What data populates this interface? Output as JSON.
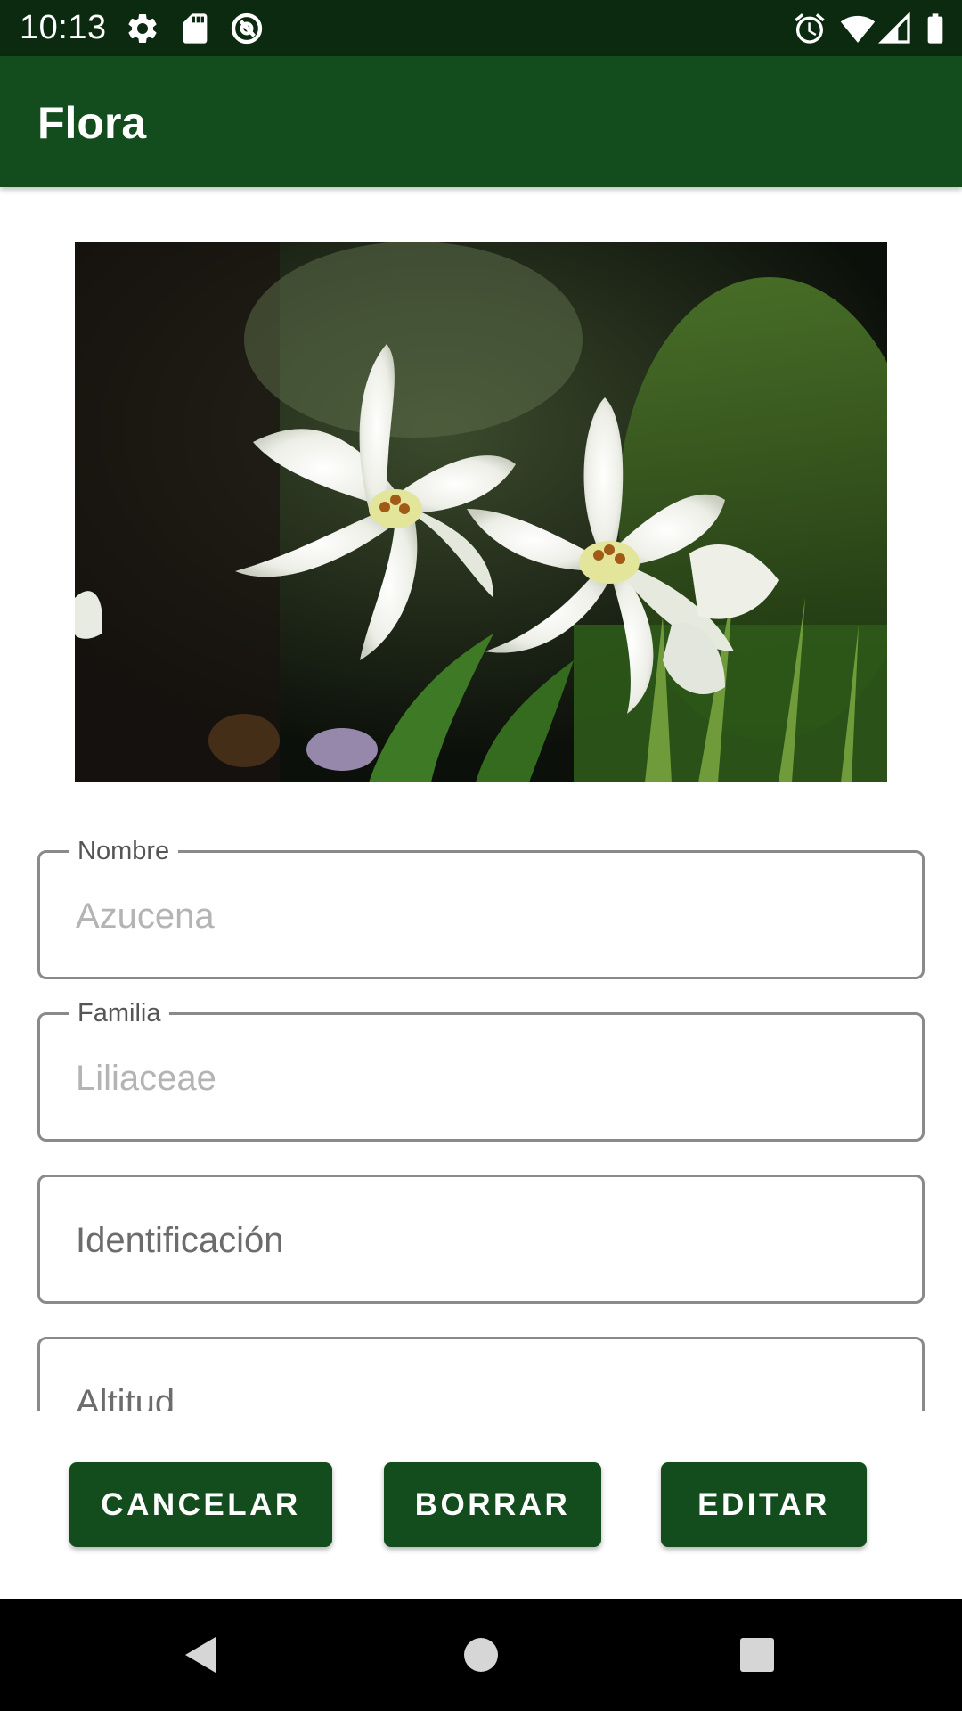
{
  "status_bar": {
    "time": "10:13",
    "left_icons": [
      "settings-icon",
      "sd-card-icon",
      "vpn-icon"
    ],
    "right_icons": [
      "alarm-icon",
      "wifi-icon",
      "signal-icon",
      "battery-icon"
    ]
  },
  "app_bar": {
    "title": "Flora"
  },
  "photo": {
    "subject": "white-lily-flowers"
  },
  "form": {
    "fields": [
      {
        "label": "Nombre",
        "value": "Azucena"
      },
      {
        "label": "Familia",
        "value": "Liliaceae"
      },
      {
        "placeholder": "Identificación"
      },
      {
        "placeholder": "Altitud"
      }
    ]
  },
  "actions": {
    "cancel_label": "CANCELAR",
    "delete_label": "BORRAR",
    "edit_label": "EDITAR"
  },
  "nav_bar": {
    "icons": [
      "back-icon",
      "home-icon",
      "recents-icon"
    ]
  },
  "colors": {
    "primary": "#134d1d",
    "primary_dark": "#0b2a0f",
    "outline": "#8a8a8a"
  }
}
